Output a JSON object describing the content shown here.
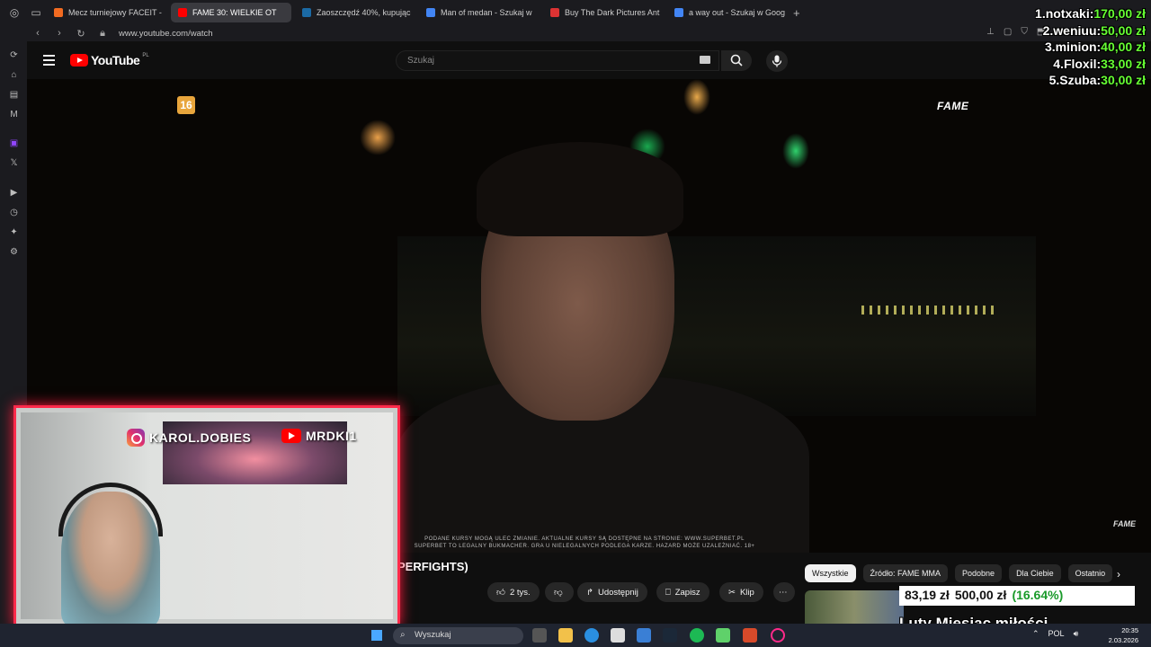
{
  "browser": {
    "tabs": [
      {
        "label": "Mecz turniejowy FACEIT -",
        "color": "#f26b21",
        "active": false
      },
      {
        "label": "FAME 30: WIELKIE OT",
        "color": "#ff0000",
        "active": true
      },
      {
        "label": "Zaoszczędź 40%, kupując",
        "color": "#1b6aa5",
        "active": false
      },
      {
        "label": "Man of medan - Szukaj w",
        "color": "#4285f4",
        "active": false
      },
      {
        "label": "Buy The Dark Pictures Ant",
        "color": "#d33",
        "active": false
      },
      {
        "label": "a way out - Szukaj w Goog",
        "color": "#4285f4",
        "active": false
      }
    ],
    "url": "www.youtube.com/watch"
  },
  "youtube": {
    "logo": "YouTube",
    "region": "PL",
    "search_placeholder": "Szukaj"
  },
  "player": {
    "age_badge": "16",
    "brand": "FAME",
    "brand_small": "FAME",
    "disclaimer_line1": "PODANE KURSY MOGĄ ULEC ZMIANIE. AKTUALNE KURSY SĄ DOSTĘPNE NA STRONIE: WWW.SUPERBET.PL",
    "disclaimer_line2": "SUPERBET TO LEGALNY BUKMACHER. GRA U NIELEGALNYCH PODLEGA KARZE. HAZARD MOŻE UZALEŻNIAĆ. 18+"
  },
  "video": {
    "title_fragment": "PERFIGHTS)",
    "likes": "2 tys.",
    "share": "Udostępnij",
    "save": "Zapisz",
    "clip": "Klip",
    "more": "⋯"
  },
  "chips": [
    "Wszystkie",
    "Źródło: FAME MMA",
    "Podobne",
    "Dla Ciebie",
    "Ostatnio"
  ],
  "donations": [
    {
      "name": "1.notxaki:",
      "amount": "170,00 zł"
    },
    {
      "name": "2.weniuu:",
      "amount": "50,00 zł"
    },
    {
      "name": "3.minion:",
      "amount": "40,00 zł"
    },
    {
      "name": "4.Floxil:",
      "amount": "33,00 zł"
    },
    {
      "name": "5.Szuba:",
      "amount": "30,00 zł"
    }
  ],
  "webcam": {
    "instagram": "KAROL.DOBIES",
    "youtube": "MRDKI1"
  },
  "overlay": {
    "price_current": "83,19 zł",
    "price_goal": "500,00 zł",
    "price_pct": "(16.64%)",
    "message": "Luty Miesiąc miłości"
  },
  "taskbar": {
    "search": "Wyszukaj",
    "lang": "POL",
    "time": "20:35",
    "date": "2.03.2026"
  }
}
